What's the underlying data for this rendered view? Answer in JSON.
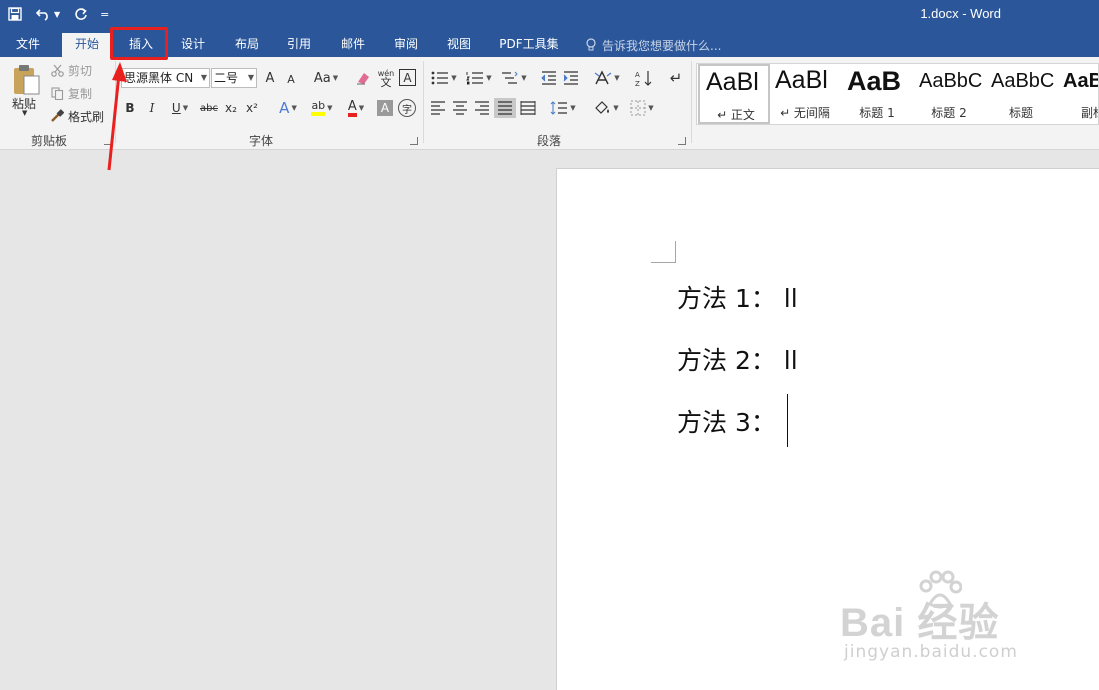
{
  "window": {
    "title": "1.docx - Word"
  },
  "quick_access": {
    "save_icon": "save-icon",
    "undo_icon": "undo-icon",
    "redo_icon": "redo-icon",
    "customize": "="
  },
  "tabs": [
    {
      "label": "文件"
    },
    {
      "label": "开始",
      "active": true
    },
    {
      "label": "插入",
      "highlighted": true
    },
    {
      "label": "设计"
    },
    {
      "label": "布局"
    },
    {
      "label": "引用"
    },
    {
      "label": "邮件"
    },
    {
      "label": "审阅"
    },
    {
      "label": "视图"
    },
    {
      "label": "PDF工具集"
    }
  ],
  "tell_me": {
    "placeholder": "告诉我您想要做什么..."
  },
  "clipboard": {
    "paste": "粘贴",
    "cut": "剪切",
    "copy": "复制",
    "format_painter": "格式刷",
    "group_label": "剪贴板"
  },
  "font": {
    "font_name": "思源黑体 CN",
    "font_size": "二号",
    "grow": "A",
    "shrink": "A",
    "change_case": "Aa",
    "phonetic_top": "wén",
    "phonetic_bottom": "文",
    "border_char": "A",
    "bold": "B",
    "italic": "I",
    "underline": "U",
    "strikethrough": "abc",
    "subscript": "x₂",
    "superscript": "x²",
    "text_effects": "A",
    "highlight": "ab",
    "font_color": "A",
    "shading": "A",
    "enclose": "字",
    "group_label": "字体"
  },
  "paragraph": {
    "group_label": "段落"
  },
  "styles": [
    {
      "sample": "AaBl",
      "name": "↵ 正文",
      "selected": true
    },
    {
      "sample": "AaBl",
      "name": "↵ 无间隔"
    },
    {
      "sample": "AaB",
      "name": "标题 1",
      "bold": true
    },
    {
      "sample": "AaBbC",
      "name": "标题 2"
    },
    {
      "sample": "AaBbC",
      "name": "标题"
    },
    {
      "sample": "AaB",
      "name": "副标",
      "bold": true
    }
  ],
  "document": {
    "lines": [
      "方法 1：  ll",
      "方法 2：  ll",
      "方法 3："
    ]
  },
  "watermark": {
    "brand": "Bai 经验",
    "url": "jingyan.baidu.com"
  },
  "colors": {
    "title_bar": "#2b579a",
    "annotation_red": "#e8211e",
    "ribbon": "#f3f3f3",
    "highlight_yellow": "#ffff00",
    "font_red": "#e8211e"
  }
}
